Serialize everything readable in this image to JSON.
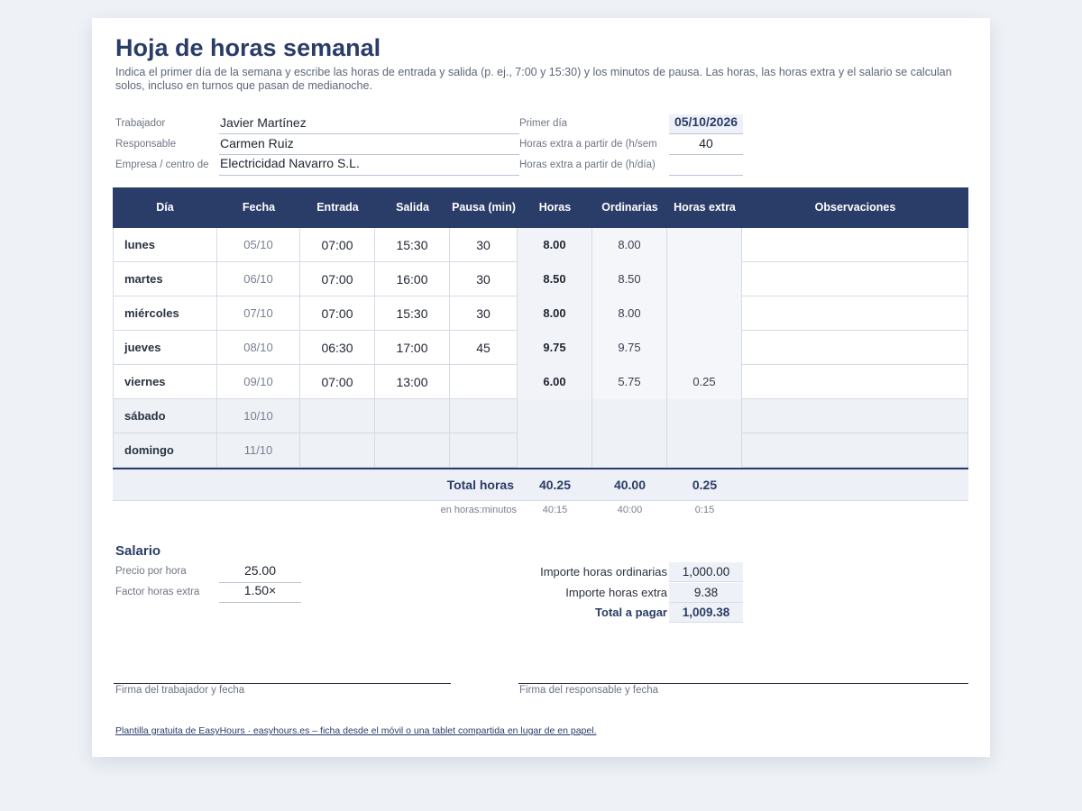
{
  "title": "Hoja de horas semanal",
  "subtitle": "Indica el primer día de la semana y escribe las horas de entrada y salida (p. ej., 7:00 y 15:30) y los minutos de pausa. Las horas, las horas extra y el salario se calculan solos, incluso en turnos que pasan de medianoche.",
  "info": {
    "worker_label": "Trabajador",
    "worker_value": "Javier Martínez",
    "manager_label": "Responsable",
    "manager_value": "Carmen Ruiz",
    "company_label": "Empresa / centro de",
    "company_value": "Electricidad Navarro S.L.",
    "first_day_label": "Primer día",
    "first_day_value": "05/10/2026",
    "ot_week_label": "Horas extra a partir de (h/sem",
    "ot_week_value": "40",
    "ot_day_label": "Horas extra a partir de (h/día)",
    "ot_day_value": ""
  },
  "table": {
    "headers": [
      "Día",
      "Fecha",
      "Entrada",
      "Salida",
      "Pausa (min)",
      "Horas",
      "Ordinarias",
      "Horas extra",
      "Observaciones"
    ],
    "rows": [
      {
        "day": "lunes",
        "date": "05/10",
        "in": "07:00",
        "out": "15:30",
        "pause": "30",
        "hours": "8.00",
        "ord": "8.00",
        "extra": "",
        "notes": ""
      },
      {
        "day": "martes",
        "date": "06/10",
        "in": "07:00",
        "out": "16:00",
        "pause": "30",
        "hours": "8.50",
        "ord": "8.50",
        "extra": "",
        "notes": ""
      },
      {
        "day": "miércoles",
        "date": "07/10",
        "in": "07:00",
        "out": "15:30",
        "pause": "30",
        "hours": "8.00",
        "ord": "8.00",
        "extra": "",
        "notes": ""
      },
      {
        "day": "jueves",
        "date": "08/10",
        "in": "06:30",
        "out": "17:00",
        "pause": "45",
        "hours": "9.75",
        "ord": "9.75",
        "extra": "",
        "notes": ""
      },
      {
        "day": "viernes",
        "date": "09/10",
        "in": "07:00",
        "out": "13:00",
        "pause": "",
        "hours": "6.00",
        "ord": "5.75",
        "extra": "0.25",
        "notes": ""
      },
      {
        "day": "sábado",
        "date": "10/10",
        "in": "",
        "out": "",
        "pause": "",
        "hours": "",
        "ord": "",
        "extra": "",
        "notes": ""
      },
      {
        "day": "domingo",
        "date": "11/10",
        "in": "",
        "out": "",
        "pause": "",
        "hours": "",
        "ord": "",
        "extra": "",
        "notes": ""
      }
    ],
    "totals": {
      "label": "Total horas",
      "hours": "40.25",
      "ord": "40.00",
      "extra": "0.25",
      "hm_label": "en horas:minutos",
      "hours_hm": "40:15",
      "ord_hm": "40:00",
      "extra_hm": "0:15"
    }
  },
  "salary": {
    "title": "Salario",
    "rate_label": "Precio por hora",
    "rate_value": "25.00",
    "factor_label": "Factor horas extra",
    "factor_value": "1.50×",
    "ord_amount_label": "Importe horas ordinarias",
    "ord_amount_value": "1,000.00",
    "extra_amount_label": "Importe horas extra",
    "extra_amount_value": "9.38",
    "total_label": "Total a pagar",
    "total_value": "1,009.38"
  },
  "signatures": {
    "worker": "Firma del trabajador y fecha",
    "manager": "Firma del responsable y fecha"
  },
  "footer": "Plantilla gratuita de EasyHours · easyhours.es – ficha desde el móvil o una tablet compartida en lugar de en papel."
}
